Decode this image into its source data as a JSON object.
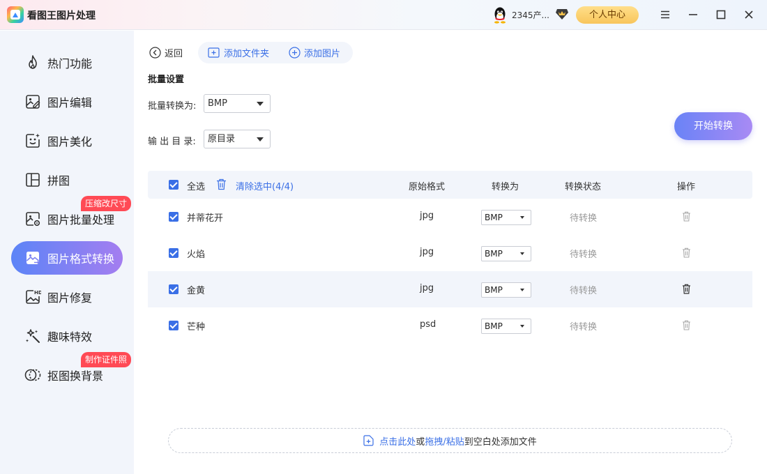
{
  "app": {
    "title": "看图王图片处理"
  },
  "titlebar": {
    "user_name": "2345产...",
    "profile_label": "个人中心"
  },
  "sidebar": {
    "items": [
      {
        "label": "热门功能",
        "icon": "fire-icon"
      },
      {
        "label": "图片编辑",
        "icon": "image-edit-icon"
      },
      {
        "label": "图片美化",
        "icon": "image-beautify-icon"
      },
      {
        "label": "拼图",
        "icon": "collage-icon"
      },
      {
        "label": "图片批量处理",
        "icon": "batch-image-icon",
        "badge": "压缩改尺寸"
      },
      {
        "label": "图片格式转换",
        "icon": "format-convert-icon",
        "active": true
      },
      {
        "label": "图片修复",
        "icon": "hd-image-icon"
      },
      {
        "label": "趣味特效",
        "icon": "magic-wand-icon"
      },
      {
        "label": "抠图换背景",
        "icon": "cutout-icon",
        "badge": "制作证件照"
      }
    ]
  },
  "toolbar": {
    "back_label": "返回",
    "add_folder_label": "添加文件夹",
    "add_image_label": "添加图片"
  },
  "batch": {
    "section_title": "批量设置",
    "convert_label": "批量转换为:",
    "convert_value": "BMP",
    "output_label": "输 出 目 录:",
    "output_value": "原目录",
    "start_label": "开始转换"
  },
  "table": {
    "select_all_label": "全选",
    "clear_selected_label": "清除选中(4/4)",
    "headers": {
      "format": "原始格式",
      "convert_to": "转换为",
      "status": "转换状态",
      "action": "操作"
    },
    "rows": [
      {
        "name": "并蒂花开",
        "format": "jpg",
        "target": "BMP",
        "status": "待转换",
        "checked": true
      },
      {
        "name": "火焰",
        "format": "jpg",
        "target": "BMP",
        "status": "待转换",
        "checked": true
      },
      {
        "name": "金黄",
        "format": "jpg",
        "target": "BMP",
        "status": "待转换",
        "checked": true
      },
      {
        "name": "芒种",
        "format": "psd",
        "target": "BMP",
        "status": "待转换",
        "checked": true
      }
    ]
  },
  "dropzone": {
    "link1": "点击此处",
    "or": "或",
    "link2": "拖拽/粘贴",
    "suffix": "到空白处添加文件"
  },
  "colors": {
    "accent": "#3a6fe6",
    "active_gradient_start": "#5c84f7",
    "active_gradient_end": "#a47ef0",
    "badge": "#ff4a55",
    "profile_button": "#f8c55b"
  }
}
